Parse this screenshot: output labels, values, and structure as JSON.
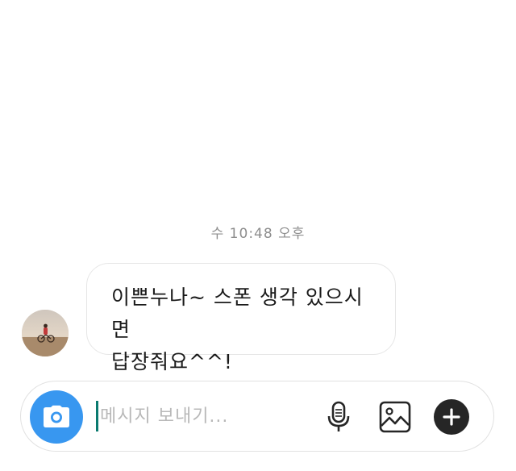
{
  "thread": {
    "timestamp": "수 10:48 오후"
  },
  "message": {
    "line1": "이쁜누나~ 스폰 생각 있으시면",
    "line2": "답장줘요^^!"
  },
  "composer": {
    "placeholder": "메시지 보내기..."
  },
  "icons": {
    "avatar": "profile-photo",
    "camera": "camera-icon",
    "mic": "microphone-icon",
    "gallery": "image-icon",
    "plus": "plus-icon"
  },
  "colors": {
    "camera_button": "#3897f0",
    "plus_button": "#262626",
    "caret": "#0a7a6f",
    "timestamp": "#8e8e8e"
  }
}
